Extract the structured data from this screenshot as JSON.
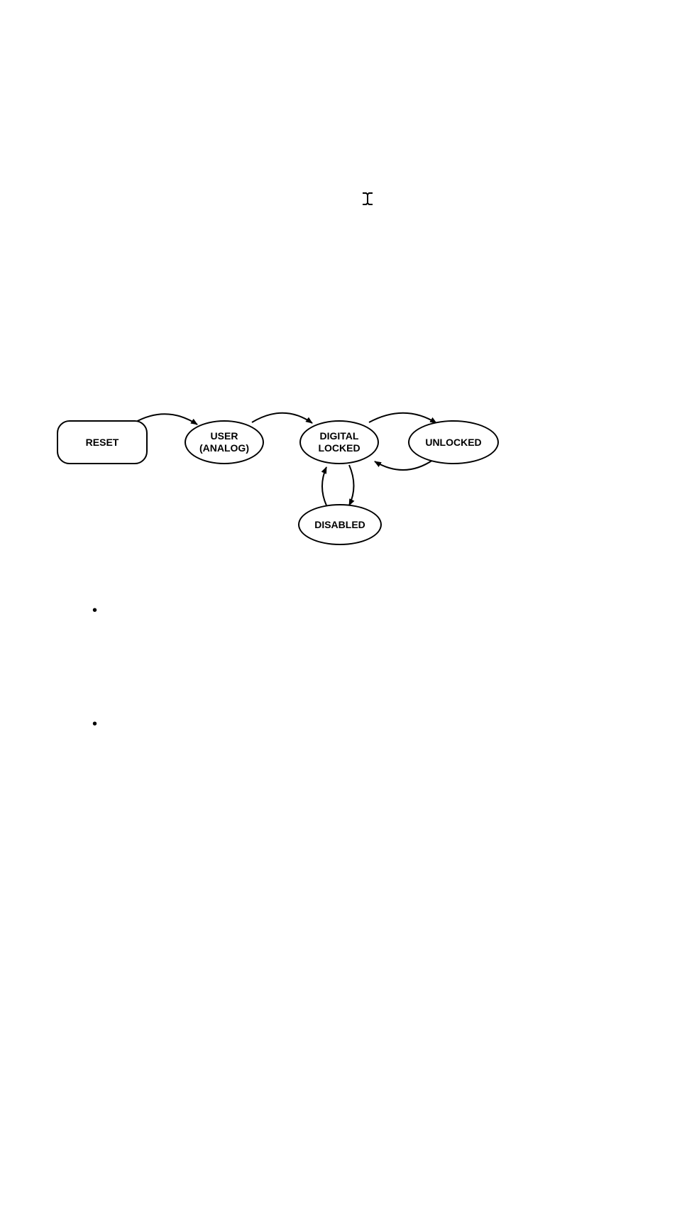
{
  "diagram": {
    "nodes": {
      "reset": "RESET",
      "user_analog_l1": "USER",
      "user_analog_l2": "(ANALOG)",
      "digital_locked_l1": "DIGITAL",
      "digital_locked_l2": "LOCKED",
      "unlocked": "UNLOCKED",
      "disabled": "DISABLED"
    },
    "edges": [
      {
        "from": "RESET",
        "to": "USER (ANALOG)"
      },
      {
        "from": "USER (ANALOG)",
        "to": "DIGITAL LOCKED"
      },
      {
        "from": "DIGITAL LOCKED",
        "to": "UNLOCKED"
      },
      {
        "from": "UNLOCKED",
        "to": "DIGITAL LOCKED"
      },
      {
        "from": "DIGITAL LOCKED",
        "to": "DISABLED"
      },
      {
        "from": "DISABLED",
        "to": "DIGITAL LOCKED"
      }
    ]
  },
  "cursor_glyph": "I",
  "bullets": [
    "•",
    "•"
  ]
}
